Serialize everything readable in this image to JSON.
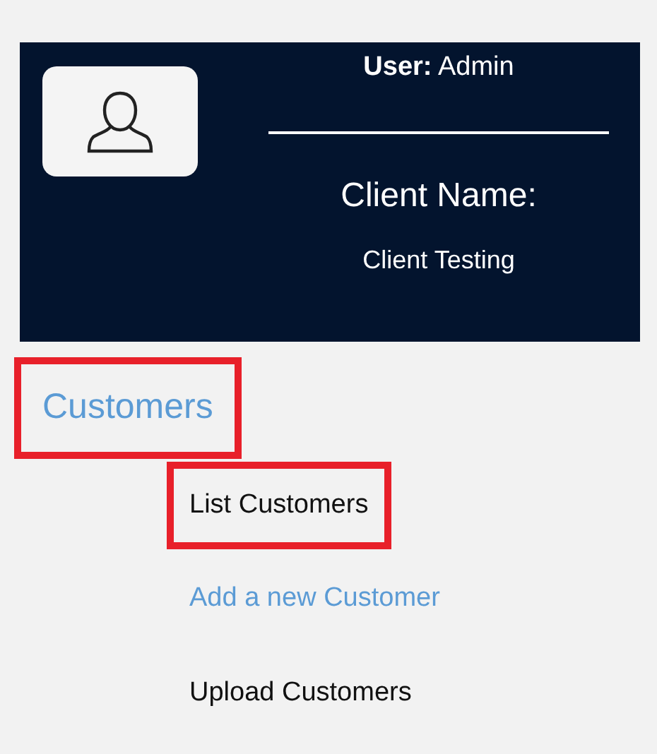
{
  "profile": {
    "user_label": "User:",
    "user_name": "Admin",
    "client_label": "Client Name:",
    "client_name": "Client Testing"
  },
  "menu": {
    "label": "Customers",
    "kind": "link",
    "highlighted": true,
    "children": [
      {
        "label": "List Customers",
        "kind": "plain",
        "highlighted": true
      },
      {
        "label": "Add a new Customer",
        "kind": "link",
        "highlighted": false
      },
      {
        "label": "Upload Customers",
        "kind": "plain",
        "highlighted": false
      }
    ]
  }
}
